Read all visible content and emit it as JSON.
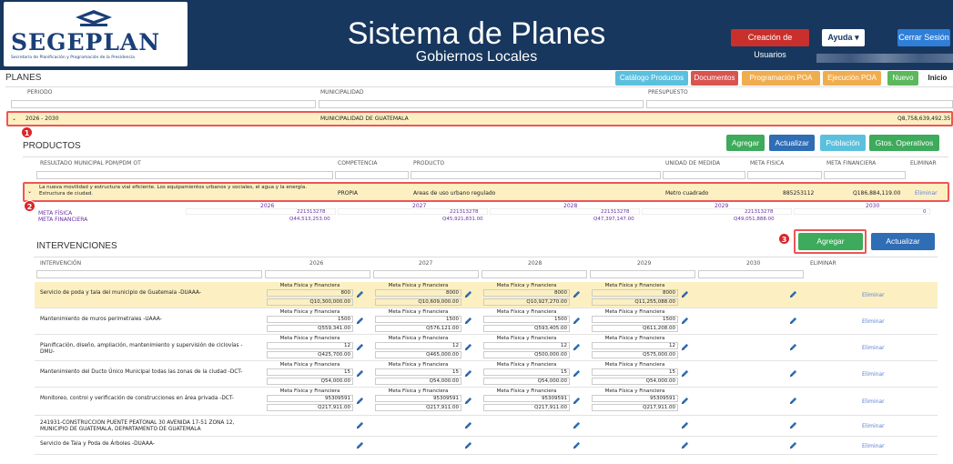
{
  "header": {
    "logo_text": "SEGEPLAN",
    "logo_sub": "Secretaría de Planificación y Programación de la Presidencia",
    "title": "Sistema de Planes",
    "subtitle": "Gobiernos Locales",
    "btn_users": "Creación de Usuarios",
    "btn_help": "Ayuda ▾",
    "btn_logout": "Cerrar Sesión"
  },
  "toolbar": {
    "section": "PLANES",
    "nav": [
      "Catálogo Productos",
      "Documentos",
      "Programación POA",
      "Ejecución POA",
      "Nuevo",
      "Inicio"
    ]
  },
  "planes": {
    "headers": [
      "PERIODO",
      "MUNICIPALIDAD",
      "PRESUPUESTO"
    ],
    "row": {
      "periodo": "2026 - 2030",
      "municipalidad": "MUNICIPALIDAD DE GUATEMALA",
      "presupuesto": "Q8,758,639,492.35"
    }
  },
  "badges": [
    "1",
    "2",
    "3"
  ],
  "productos": {
    "title": "PRODUCTOS",
    "buttons": [
      "Agregar",
      "Actualizar",
      "Población",
      "Gtos. Operativos"
    ],
    "headers": [
      "RESULTADO MUNICIPAL PDM/PDM OT",
      "COMPETENCIA",
      "PRODUCTO",
      "UNIDAD DE MEDIDA",
      "META FISICA",
      "META FINANCIERA",
      "ELIMINAR"
    ],
    "row": {
      "resultado": "La nueva movilidad y estructura vial eficiente. Los equipamientos urbanos y sociales, el agua y la energía. Estructura de ciudad.",
      "competencia": "PROPIA",
      "producto": "Areas de uso urbano regulado",
      "unidad": "Metro cuadrado",
      "meta_fisica": "885253112",
      "meta_financiera": "Q186,884,119.00",
      "eliminar": "Eliminar"
    },
    "years": [
      "2026",
      "2027",
      "2028",
      "2029",
      "2030"
    ],
    "meta_fisica_label": "META FÍSICA",
    "meta_financiera_label": "META FINANCIERA",
    "metas_fisicas": [
      "221313278",
      "221313278",
      "221313278",
      "221313278",
      "0"
    ],
    "metas_financieras": [
      "Q44,513,253.00",
      "Q45,921,831.00",
      "Q47,397,147.00",
      "Q49,051,888.00"
    ]
  },
  "intervenciones": {
    "title": "INTERVENCIONES",
    "buttons": [
      "Agregar",
      "Actualizar"
    ],
    "headers": [
      "INTERVENCIÓN",
      "2026",
      "2027",
      "2028",
      "2029",
      "2030",
      "ELIMINAR"
    ],
    "mf_label": "Meta Física y Financiera",
    "eliminar": "Eliminar",
    "rows": [
      {
        "name": "Servicio de poda y tala del municipio de Guatemala -DUAAA-",
        "cells": [
          [
            "800",
            "Q10,300,000.00"
          ],
          [
            "8000",
            "Q10,609,000.00"
          ],
          [
            "8000",
            "Q10,927,270.00"
          ],
          [
            "8000",
            "Q11,255,088.00"
          ]
        ]
      },
      {
        "name": "Mantenimiento de muros perimetrales -UAAA-",
        "cells": [
          [
            "1500",
            "Q559,341.00"
          ],
          [
            "1500",
            "Q576,121.00"
          ],
          [
            "1500",
            "Q593,405.00"
          ],
          [
            "1500",
            "Q611,208.00"
          ]
        ]
      },
      {
        "name": "Planificación, diseño, ampliación, mantenimiento y supervisión de ciclovías - DMU-",
        "cells": [
          [
            "12",
            "Q425,700.00"
          ],
          [
            "12",
            "Q465,000.00"
          ],
          [
            "12",
            "Q500,000.00"
          ],
          [
            "12",
            "Q575,000.00"
          ]
        ]
      },
      {
        "name": "Mantenimiento del Ducto Único Municipal todas las zonas de la ciudad -DCT-",
        "cells": [
          [
            "15",
            "Q54,000.00"
          ],
          [
            "15",
            "Q54,000.00"
          ],
          [
            "15",
            "Q54,000.00"
          ],
          [
            "15",
            "Q54,000.00"
          ]
        ]
      },
      {
        "name": "Monitoreo, control y verificación de construcciones en área privada -DCT-",
        "cells": [
          [
            "95309591",
            "Q217,911.00"
          ],
          [
            "95309591",
            "Q217,911.00"
          ],
          [
            "95309591",
            "Q217,911.00"
          ],
          [
            "95309591",
            "Q217,911.00"
          ]
        ]
      },
      {
        "name": "241931-CONSTRUCCION PUENTE PEATONAL 30 AVENIDA 17-51 ZONA 12, MUNICIPIO DE GUATEMALA, DEPARTAMENTO DE GUATEMALA",
        "cells": []
      },
      {
        "name": "Servicio de Tala y Poda de Árboles -DUAAA-",
        "cells": []
      }
    ]
  },
  "colors": {
    "header_bg": "#17375e",
    "highlight_row": "#fcf0c2",
    "badge": "#d9262a",
    "frame": "#e55555"
  }
}
